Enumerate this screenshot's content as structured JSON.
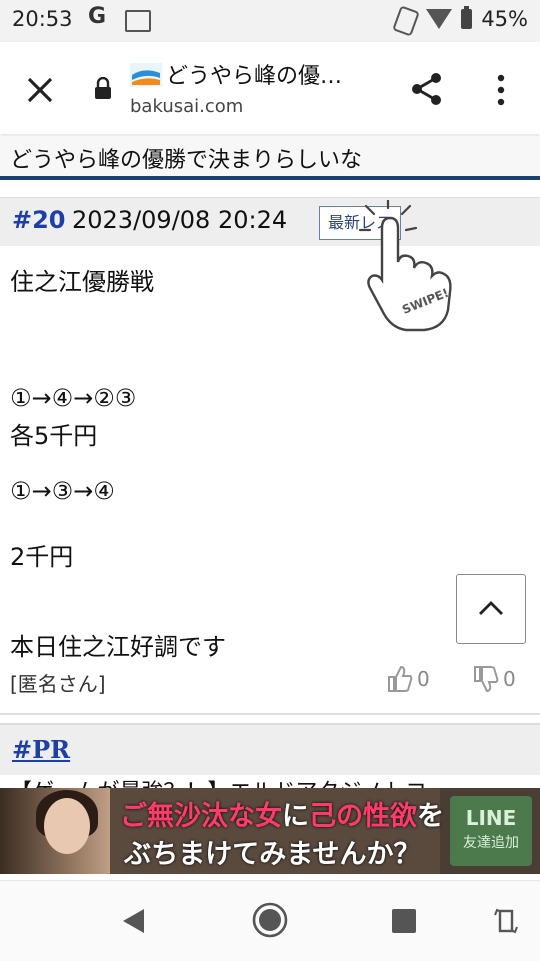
{
  "status": {
    "time": "20:53",
    "g_label": "G",
    "battery": "45%"
  },
  "browser": {
    "title": "どうやら峰の優…",
    "url": "bakusai.com"
  },
  "thread": {
    "title": "どうやら峰の優勝で決まりらしいな"
  },
  "post": {
    "number": "#20",
    "datetime": "2023/09/08 20:24",
    "latest_button": "最新レス",
    "swipe_label": "SWIPE!",
    "lines": [
      "住之江優勝戦",
      "①→④→②③",
      "各5千円",
      "①→③→④",
      "2千円",
      "本日住之江好調です"
    ],
    "author": "[匿名さん]",
    "likes": "0",
    "dislikes": "0"
  },
  "pr": {
    "label": "#PR",
    "snippet": "【ゲームが最強？！】エルドアタジノトコ"
  },
  "ad": {
    "line1_a": "ご無沙汰な女",
    "line1_b": "に",
    "line1_c": "己の性欲",
    "line1_d": "を",
    "line2": "ぶちまけてみませんか？",
    "line_btn_1": "LINE",
    "line_btn_2": "友達追加"
  },
  "colors": {
    "accent": "#1b3f73",
    "link": "#1d3fa8"
  }
}
